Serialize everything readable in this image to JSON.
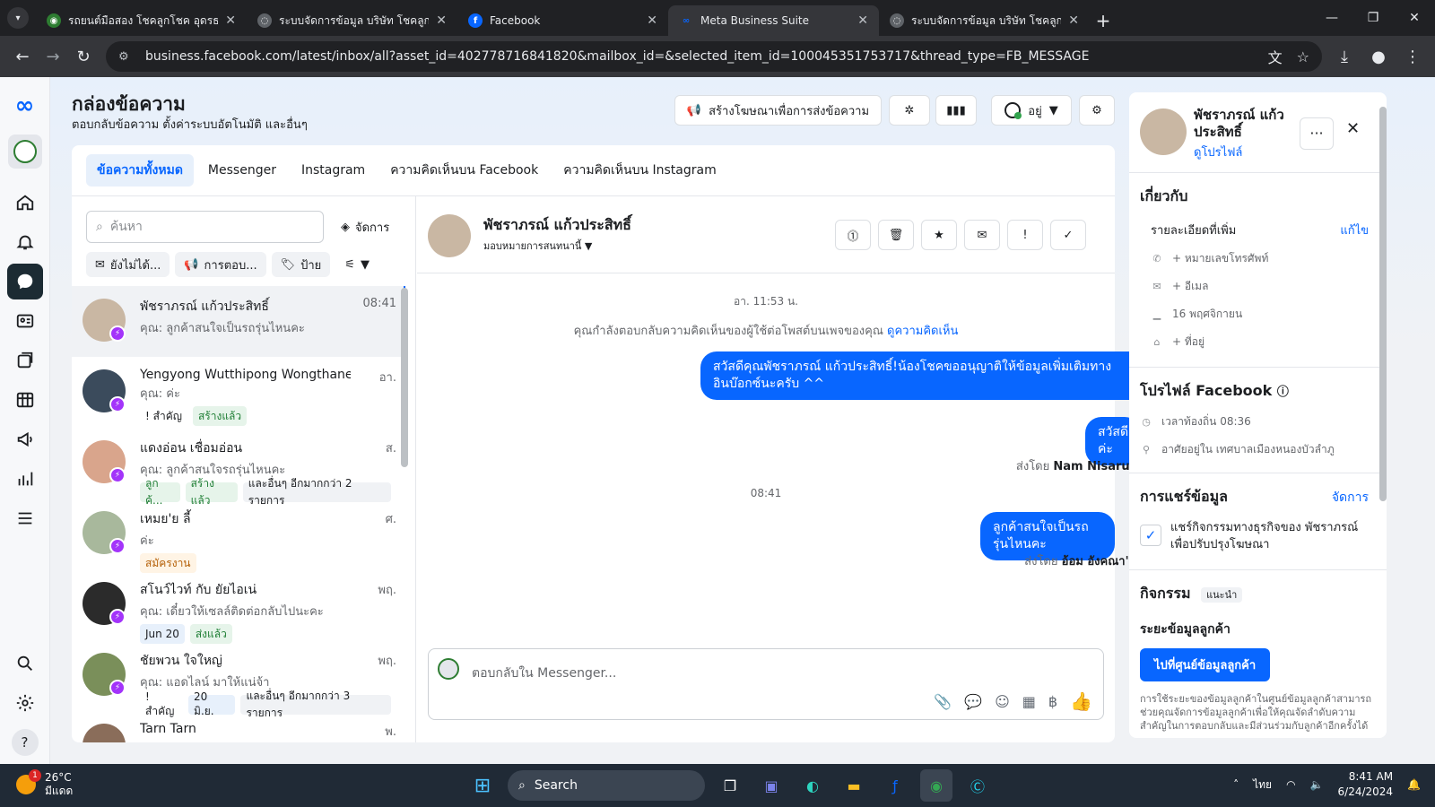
{
  "browser": {
    "tabs": [
      {
        "title": "รถยนต์มือสอง โชคลูกโชค อุดรธานี",
        "fav_color": "#2e7d32",
        "fav_glyph": "◉"
      },
      {
        "title": "ระบบจัดการข้อมูล บริษัท โชคลูกโชค",
        "fav_color": "#5f6368",
        "fav_glyph": "◌"
      },
      {
        "title": "Facebook",
        "fav_color": "#0866ff",
        "fav_glyph": "f"
      },
      {
        "title": "Meta Business Suite",
        "fav_color": "#0866ff",
        "fav_glyph": "∞",
        "active": true
      },
      {
        "title": "ระบบจัดการข้อมูล บริษัท โชคลูกโชค",
        "fav_color": "#5f6368",
        "fav_glyph": "◌"
      }
    ],
    "url": "business.facebook.com/latest/inbox/all?asset_id=402778716841820&mailbox_id=&selected_item_id=100045351753717&thread_type=FB_MESSAGE"
  },
  "header": {
    "title": "กล่องข้อความ",
    "subtitle": "ตอบกลับข้อความ ตั้งค่าระบบอัตโนมัติ และอื่นๆ",
    "create_ad_label": "สร้างโฆษณาเพื่อการส่งข้อความ",
    "status_label": "อยู่"
  },
  "filter_tabs": [
    "ข้อความทั้งหมด",
    "Messenger",
    "Instagram",
    "ความคิดเห็นบน Facebook",
    "ความคิดเห็นบน Instagram"
  ],
  "conv_list": {
    "search_placeholder": "ค้นหา",
    "manage_label": "จัดการ",
    "chips": [
      "ยังไม่ได้...",
      "การตอบ...",
      "ป้าย"
    ],
    "items": [
      {
        "name": "พัชราภรณ์ แก้วประสิทธิ์",
        "time": "08:41",
        "snippet": "คุณ: ลูกค้าสนใจเป็นรถรุ่นไหนคะ",
        "tags": [],
        "avatar_color": "#c9b7a3"
      },
      {
        "name": "Yengyong Wutthipong Wongthanee",
        "time": "อา.",
        "snippet": "คุณ: ค่ะ",
        "tags": [
          {
            "text": "! สำคัญ",
            "style": "plain"
          },
          {
            "text": "สร้างแล้ว",
            "style": "green"
          }
        ],
        "avatar_color": "#3b4b5c"
      },
      {
        "name": "แดงอ่อน เชื่อมอ่อน",
        "time": "ส.",
        "snippet": "คุณ: ลูกค้าสนใจรถรุ่นไหนคะ",
        "tags": [
          {
            "text": "ลูกค้...",
            "style": "green"
          },
          {
            "text": "สร้างแล้ว",
            "style": "green"
          },
          {
            "text": "และอื่นๆ อีกมากกว่า 2 รายการ",
            "style": "gray"
          }
        ],
        "avatar_color": "#d9a58c"
      },
      {
        "name": "เหมย'ย ลี้",
        "time": "ศ.",
        "snippet": "ค่ะ",
        "tags": [
          {
            "text": "สมัครงาน",
            "style": "orange"
          }
        ],
        "avatar_color": "#a8b89c"
      },
      {
        "name": "สโนว์ไวท์ กับ ยัยไอเน่",
        "time": "พฤ.",
        "snippet": "คุณ: เดี๋ยวให้เซลล์ติดต่อกลับไปนะคะ",
        "tags": [
          {
            "text": "Jun 20",
            "style": "blue"
          },
          {
            "text": "ส่งแล้ว",
            "style": "green"
          }
        ],
        "avatar_color": "#2b2b2b"
      },
      {
        "name": "ชัยพวน ใจใหญ่",
        "time": "พฤ.",
        "snippet": "คุณ: แอดไลน์ มาให้แน่จ้า",
        "tags": [
          {
            "text": "!สำคัญ",
            "style": "plain"
          },
          {
            "text": "20 มิ.ย.",
            "style": "blue"
          },
          {
            "text": "และอื่นๆ อีกมากกว่า 3 รายการ",
            "style": "gray"
          }
        ],
        "avatar_color": "#7a8f5a"
      },
      {
        "name": "Tarn Tarn",
        "time": "พ.",
        "snippet": "",
        "tags": [],
        "avatar_color": "#8a6d5a"
      }
    ]
  },
  "thread": {
    "name": "พัชราภรณ์ แก้วประสิทธิ์",
    "assign_label": "มอบหมายการสนทนานี้",
    "date_1": "อา. 11:53 น.",
    "note_text": "คุณกำลังตอบกลับความคิดเห็นของผู้ใช้ต่อโพสต์บนเพจของคุณ",
    "note_link": "ดูความคิดเห็น",
    "msg_1_line1": "สวัสดีคุณพัชราภรณ์ แก้วประสิทธิ์!น้องโชคขออนุญาติให้ข้อมูลเพิ่มเติมทาง",
    "msg_1_line2": "อินบ๊อกซ์นะครับ ^^",
    "msg_2": "สวัสดีค่ะ",
    "sent_by_1_prefix": "ส่งโดย",
    "sent_by_1_name": "Nam Nisarut",
    "date_2": "08:41",
    "msg_3": "ลูกค้าสนใจเป็นรถรุ่นไหนคะ",
    "sent_by_2_prefix": "ส่งโดย",
    "sent_by_2_name": "อ้อม อังคณา'า",
    "composer_placeholder": "ตอบกลับใน Messenger..."
  },
  "side": {
    "name": "พัชราภรณ์ แก้วประสิทธิ์",
    "profile_link": "ดูโปรไฟล์",
    "about_title": "เกี่ยวกับ",
    "details_label": "รายละเอียดที่เพิ่ม",
    "edit_label": "แก้ไข",
    "phone": "+ หมายเลขโทรศัพท์",
    "email": "+ อีเมล",
    "birthday": "16 พฤศจิกายน",
    "address": "+ ที่อยู่",
    "fb_profile_title": "โปรไฟล์ Facebook",
    "local_time": "เวลาท้องถิ่น 08:36",
    "lives_in": "อาศัยอยู่ใน เทศบาลเมืองหนองบัวลำภู",
    "sharing_title": "การแชร์ข้อมูล",
    "sharing_manage": "จัดการ",
    "sharing_text_1": "แชร์กิจกรรมทางธุรกิจของ พัชราภรณ์",
    "sharing_text_2": "เพื่อปรับปรุงโฆษณา",
    "activity_title": "กิจกรรม",
    "activity_badge": "แนะนำ",
    "crm_title": "ระยะข้อมูลลูกค้า",
    "crm_button": "ไปที่ศูนย์ข้อมูลลูกค้า",
    "crm_desc": "การใช้ระยะของข้อมูลลูกค้าในศูนย์ข้อมูลลูกค้าสามารถช่วยคุณจัดการข้อมูลลูกค้าเพื่อให้คุณจัดลำดับความสำคัญในการตอบกลับและมีส่วนร่วมกับลูกค้าอีกครั้งได้"
  },
  "taskbar": {
    "temp": "26°C",
    "weather": "มีแดด",
    "weather_badge": "1",
    "search_label": "Search",
    "lang": "ไทย",
    "time": "8:41 AM",
    "date": "6/24/2024"
  }
}
